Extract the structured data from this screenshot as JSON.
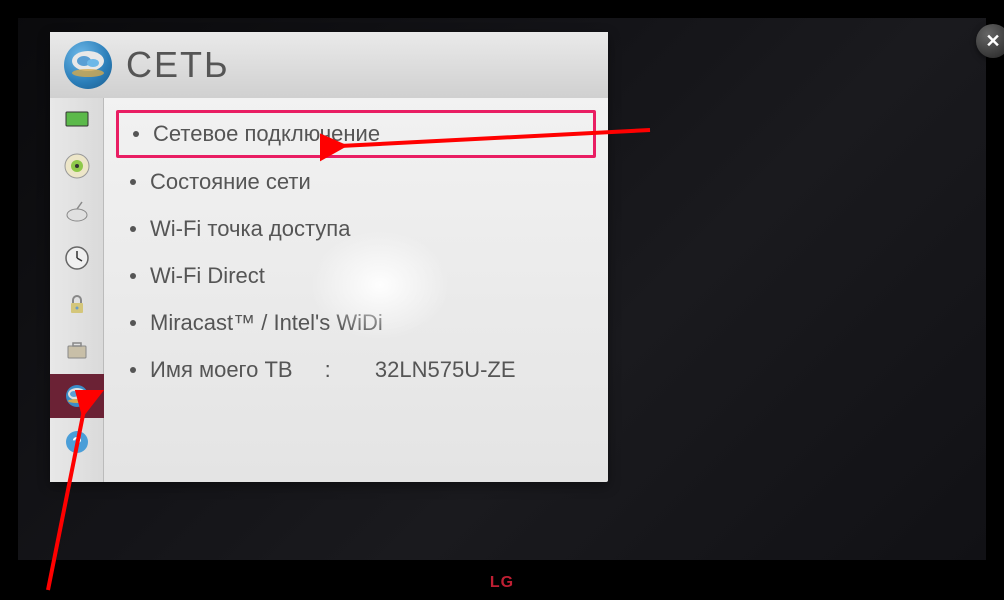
{
  "header": {
    "title": "СЕТЬ"
  },
  "tv": {
    "brand": "LG"
  },
  "menu": {
    "items": [
      {
        "label": "Сетевое подключение"
      },
      {
        "label": "Состояние сети"
      },
      {
        "label": "Wi-Fi точка доступа"
      },
      {
        "label": "Wi-Fi Direct"
      },
      {
        "label": "Miracast™ / Intel's WiDi"
      },
      {
        "label": "Имя моего ТВ",
        "value": "32LN575U-ZE"
      }
    ]
  },
  "sidebar": {
    "items": [
      {
        "name": "picture"
      },
      {
        "name": "sound"
      },
      {
        "name": "channel"
      },
      {
        "name": "time"
      },
      {
        "name": "lock"
      },
      {
        "name": "options"
      },
      {
        "name": "network",
        "active": true
      },
      {
        "name": "support"
      }
    ]
  }
}
